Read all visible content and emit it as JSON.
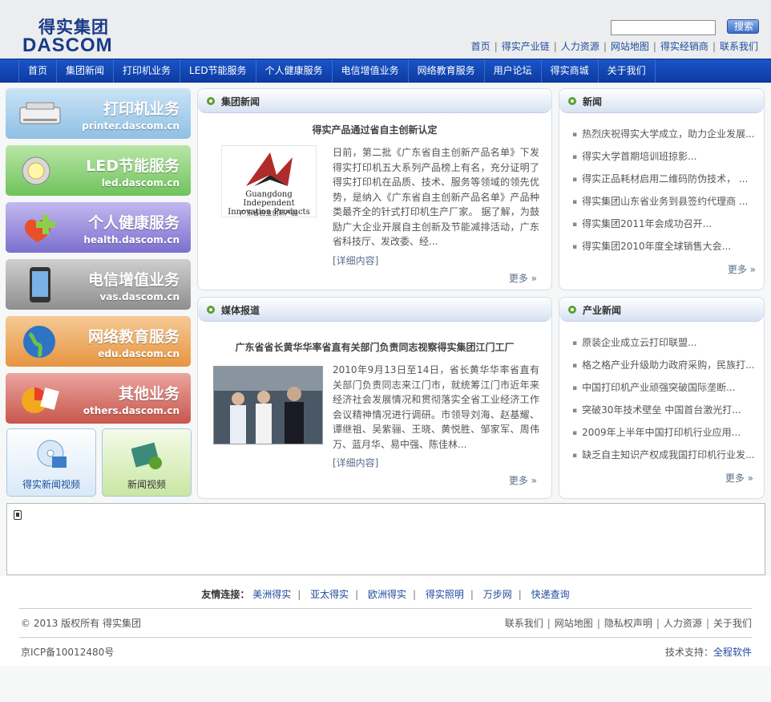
{
  "header": {
    "logo_cn": "得实集团",
    "logo_en_a": "DASCOM",
    "search_placeholder": "",
    "search_button": "搜索",
    "top_links": [
      "首页",
      "得实产业链",
      "人力资源",
      "网站地图",
      "得实经销商",
      "联系我们"
    ]
  },
  "nav": [
    "首页",
    "集团新闻",
    "打印机业务",
    "LED节能服务",
    "个人健康服务",
    "电信增值业务",
    "网络教育服务",
    "用户论坛",
    "得实商城",
    "关于我们"
  ],
  "sidebar": {
    "banners": [
      {
        "title": "打印机业务",
        "url": "printer.dascom.cn",
        "icon": "printer-icon"
      },
      {
        "title": "LED节能服务",
        "url": "led.dascom.cn",
        "icon": "led-bulb-icon"
      },
      {
        "title": "个人健康服务",
        "url": "health.dascom.cn",
        "icon": "health-cross-icon"
      },
      {
        "title": "电信增值业务",
        "url": "vas.dascom.cn",
        "icon": "phone-icon"
      },
      {
        "title": "网络教育服务",
        "url": "edu.dascom.cn",
        "icon": "globe-icon"
      },
      {
        "title": "其他业务",
        "url": "others.dascom.cn",
        "icon": "pie-chart-icon"
      }
    ],
    "videos": [
      {
        "label": "得实新闻视频",
        "icon": "disc-video-icon"
      },
      {
        "label": "新闻视频",
        "icon": "film-icon"
      }
    ]
  },
  "group_news": {
    "title": "集团新闻",
    "headline": "得实产品通过省自主创新认定",
    "image_caption_en": "Guangdong Independent Innovation Products",
    "image_caption_cn": "广东省自主创新产品",
    "paragraph": "日前，第二批《广东省自主创新产品名单》下发得实打印机五大系列产品榜上有名，充分证明了得实打印机在品质、技术、服务等领域的领先优势，是纳入《广东省自主创新产品名单》产品种类最齐全的针式打印机生产厂家。 据了解，为鼓励广大企业开展自主创新及节能减排活动，广东省科技厅、发改委、经...",
    "detail": "[详细内容]",
    "more": "更多 »"
  },
  "news": {
    "title": "新闻",
    "items": [
      "热烈庆祝得实大学成立，助力企业发展...",
      "得实大学首期培训班掠影...",
      "得实正品耗材启用二维码防伪技术， ...",
      "得实集团山东省业务到县签约代理商 ...",
      "得实集团2011年会成功召开...",
      "得实集团2010年度全球销售大会..."
    ],
    "more": "更多 »"
  },
  "media": {
    "title": "媒体报道",
    "headline": "广东省省长黄华华率省直有关部门负责同志视察得实集团江门工厂",
    "paragraph": "2010年9月13日至14日，省长黄华华率省直有关部门负责同志来江门市，就统筹江门市近年来经济社会发展情况和贯彻落实全省工业经济工作会议精神情况进行调研。市领导刘海、赵基耀、谭继祖、吴紫骊、王晓、黄悦胜、邹家军、周伟万、蓝月华、易中强、陈佳林...",
    "detail": "[详细内容]",
    "more": "更多 »"
  },
  "industry": {
    "title": "产业新闻",
    "items": [
      "原装企业成立云打印联盟...",
      "格之格产业升级助力政府采购，民族打...",
      "中国打印机产业顽强突破国际垄断...",
      "突破30年技术壁垒 中国首台激光打...",
      "2009年上半年中国打印机行业应用...",
      "缺乏自主知识产权成我国打印机行业发..."
    ],
    "more": "更多 »"
  },
  "footer": {
    "friends_label": "友情连接：",
    "friends": [
      "美洲得实",
      "亚太得实",
      "欧洲得实",
      "得实照明",
      "万步网",
      "快递查询"
    ],
    "copyright": "© 2013 版权所有 得实集团",
    "bottom_links": [
      "联系我们",
      "网站地图",
      "隐私权声明",
      "人力资源",
      "关于我们"
    ],
    "icp": "京ICP备10012480号",
    "support_label": "技术支持：",
    "support_name": "全程软件"
  },
  "colors": {
    "nav_bg": "#1a55c8",
    "link_blue": "#1f4a9c",
    "logo_blue": "#1a3a88",
    "accent_green": "#5aa12c"
  }
}
